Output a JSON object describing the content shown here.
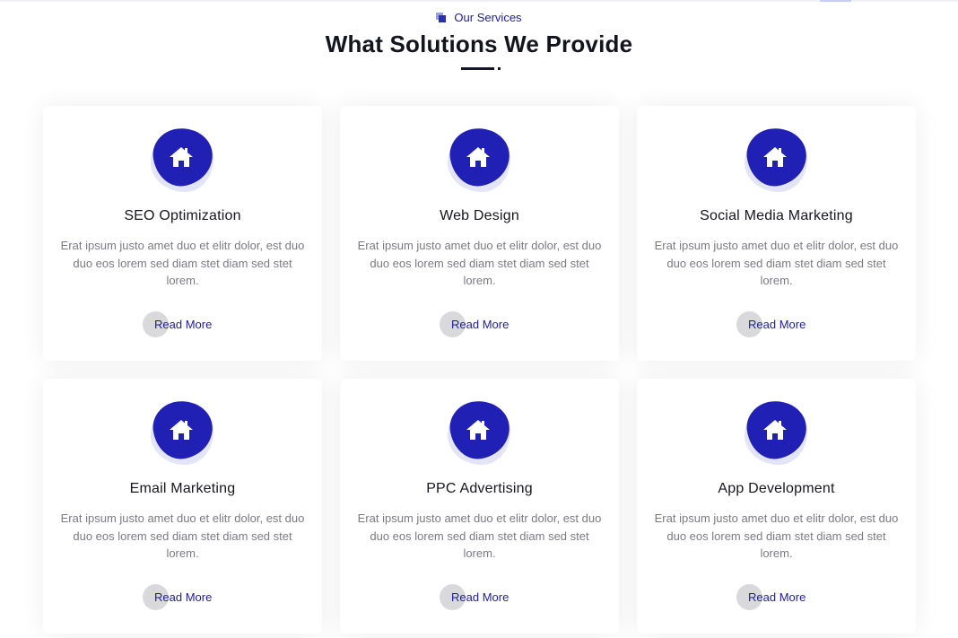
{
  "header": {
    "eyebrow": "Our Services",
    "title": "What Solutions We Provide"
  },
  "services": [
    {
      "title": "SEO Optimization",
      "description": "Erat ipsum justo amet duo et elitr dolor, est duo duo eos lorem sed diam stet diam sed stet lorem.",
      "cta": "Read More",
      "icon": "home-icon"
    },
    {
      "title": "Web Design",
      "description": "Erat ipsum justo amet duo et elitr dolor, est duo duo eos lorem sed diam stet diam sed stet lorem.",
      "cta": "Read More",
      "icon": "home-icon"
    },
    {
      "title": "Social Media Marketing",
      "description": "Erat ipsum justo amet duo et elitr dolor, est duo duo eos lorem sed diam stet diam sed stet lorem.",
      "cta": "Read More",
      "icon": "home-icon"
    },
    {
      "title": "Email Marketing",
      "description": "Erat ipsum justo amet duo et elitr dolor, est duo duo eos lorem sed diam stet diam sed stet lorem.",
      "cta": "Read More",
      "icon": "home-icon"
    },
    {
      "title": "PPC Advertising",
      "description": "Erat ipsum justo amet duo et elitr dolor, est duo duo eos lorem sed diam stet diam sed stet lorem.",
      "cta": "Read More",
      "icon": "home-icon"
    },
    {
      "title": "App Development",
      "description": "Erat ipsum justo amet duo et elitr dolor, est duo duo eos lorem sed diam stet diam sed stet lorem.",
      "cta": "Read More",
      "icon": "home-icon"
    }
  ],
  "colors": {
    "accent": "#2020b4",
    "accent_text": "#1c1c9e",
    "title_text": "#14141f",
    "body_text": "#7a7a85"
  }
}
